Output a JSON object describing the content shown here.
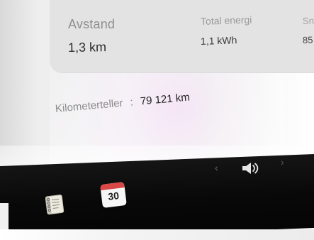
{
  "trip_summary": {
    "distance": {
      "label": "Avstand",
      "value": "1,3 km"
    },
    "total_energy": {
      "label": "Total energi",
      "value": "1,1 kWh"
    },
    "partial_metric": {
      "label": "Sni",
      "value": "85"
    }
  },
  "odometer": {
    "label": "Kilometerteller",
    "separator": ":",
    "value": "79 121 km"
  },
  "media_controls": {
    "previous_icon": "chevron-left-icon",
    "volume_icon": "speaker-icon",
    "next_icon": "chevron-right-icon"
  },
  "dock": {
    "notes_icon": "notes-icon",
    "calendar": {
      "icon": "calendar-icon",
      "day": "30"
    }
  },
  "colors": {
    "calendar_accent": "#d94747",
    "taskbar_background": "#080808",
    "card_background": "#e3e3e3"
  }
}
